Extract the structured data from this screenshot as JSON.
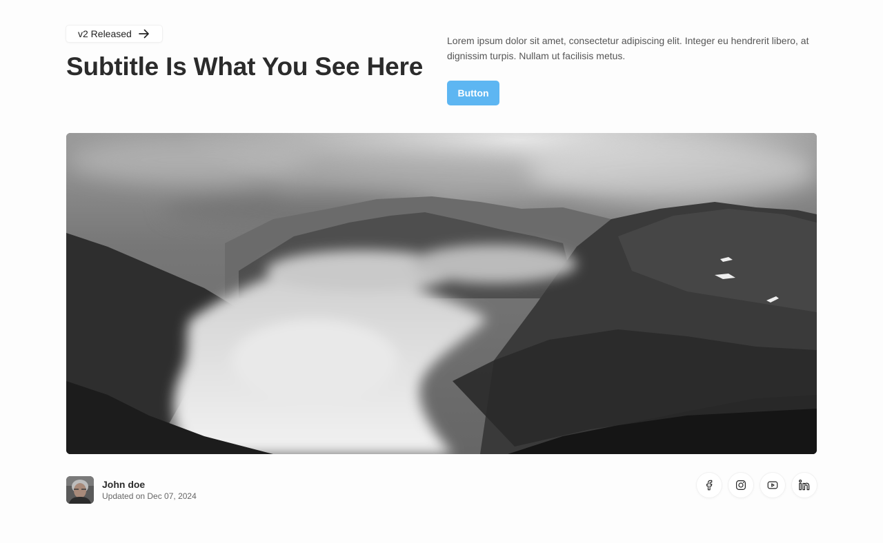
{
  "header": {
    "badge_label": "v2 Released",
    "badge_icon": "arrow-right-icon",
    "title": "Subtitle Is What You See Here",
    "description": "Lorem ipsum dolor sit amet, consectetur adipiscing elit. Integer eu hendrerit libero, at dignissim turpis. Nullam ut facilisis metus.",
    "button_label": "Button"
  },
  "hero": {
    "image": "black-and-white-mountain-landscape-with-clouds"
  },
  "author": {
    "name": "John doe",
    "updated": "Updated on Dec 07, 2024",
    "avatar": "author-avatar"
  },
  "socials": [
    {
      "name": "facebook",
      "icon": "facebook-icon"
    },
    {
      "name": "instagram",
      "icon": "instagram-icon"
    },
    {
      "name": "youtube",
      "icon": "youtube-icon"
    },
    {
      "name": "linkedin",
      "icon": "linkedin-icon"
    }
  ],
  "colors": {
    "accent": "#5db6f2",
    "text": "#2b2b2b",
    "muted": "#555555",
    "background": "#fdfdfd"
  }
}
